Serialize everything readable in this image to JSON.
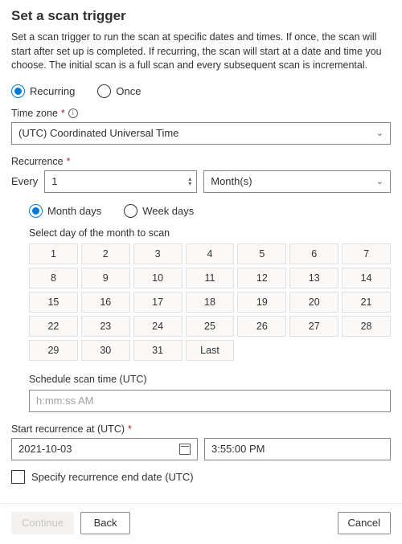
{
  "title": "Set a scan trigger",
  "description": "Set a scan trigger to run the scan at specific dates and times. If once, the scan will start after set up is completed. If recurring, the scan will start at a date and time you choose. The initial scan is a full scan and every subsequent scan is incremental.",
  "frequency": {
    "recurring_label": "Recurring",
    "once_label": "Once",
    "selected": "recurring"
  },
  "timezone": {
    "label": "Time zone",
    "value": "(UTC) Coordinated Universal Time"
  },
  "recurrence": {
    "label": "Recurrence",
    "every_label": "Every",
    "every_value": "1",
    "unit_value": "Month(s)",
    "mode": {
      "month_days_label": "Month days",
      "week_days_label": "Week days",
      "selected": "month"
    },
    "select_day_label": "Select day of the month to scan",
    "days": [
      "1",
      "2",
      "3",
      "4",
      "5",
      "6",
      "7",
      "8",
      "9",
      "10",
      "11",
      "12",
      "13",
      "14",
      "15",
      "16",
      "17",
      "18",
      "19",
      "20",
      "21",
      "22",
      "23",
      "24",
      "25",
      "26",
      "27",
      "28",
      "29",
      "30",
      "31",
      "Last"
    ]
  },
  "scan_time": {
    "label": "Schedule scan time (UTC)",
    "placeholder": "h:mm:ss AM"
  },
  "start": {
    "label": "Start recurrence at (UTC)",
    "date_value": "2021-10-03",
    "time_value": "3:55:00 PM"
  },
  "end_date": {
    "label": "Specify recurrence end date (UTC)",
    "checked": false
  },
  "footer": {
    "continue_label": "Continue",
    "back_label": "Back",
    "cancel_label": "Cancel"
  }
}
